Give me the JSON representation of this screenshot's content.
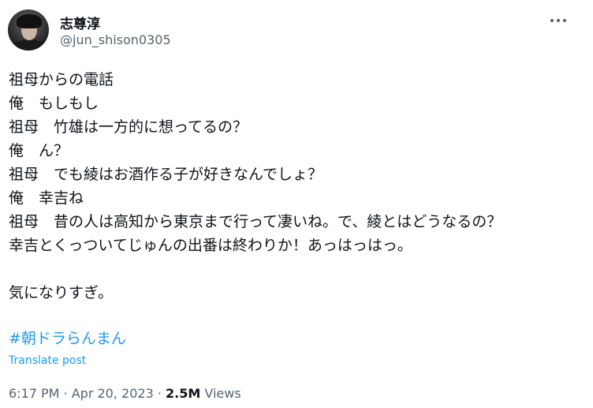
{
  "author": {
    "display_name": "志尊淳",
    "handle": "@jun_shison0305"
  },
  "tweet": {
    "lines": [
      "祖母からの電話",
      "俺　もしもし",
      "祖母　竹雄は一方的に想ってるの？",
      "俺　ん？",
      "祖母　でも綾はお酒作る子が好きなんでしょ？",
      "俺　幸吉ね",
      "祖母　昔の人は高知から東京まで行って凄いね。で、綾とはどうなるの？",
      "幸吉とくっついてじゅんの出番は終わりか！あっはっはっ。",
      "",
      "気になりすぎ。"
    ],
    "hashtag": "#朝ドラらんまん",
    "translate_label": "Translate post"
  },
  "meta": {
    "time": "6:17 PM",
    "separator1": " · ",
    "date": "Apr 20, 2023",
    "separator2": " · ",
    "views_count": "2.5M",
    "views_label": " Views"
  },
  "icons": {
    "more": "more-dots-icon",
    "avatar": "profile-avatar"
  },
  "colors": {
    "link": "#1d9bf0",
    "secondary_text": "#536471",
    "primary_text": "#0f1419"
  }
}
